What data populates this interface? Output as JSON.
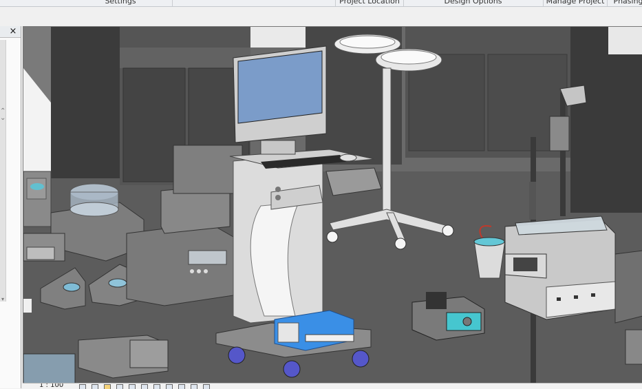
{
  "ribbon": {
    "panels": [
      {
        "label": "Settings"
      },
      {
        "label": "Project Location"
      },
      {
        "label": "Design Options"
      },
      {
        "label": "Manage Project"
      },
      {
        "label": "Phasing"
      }
    ]
  },
  "left_panel": {
    "close_glyph": "×"
  },
  "viewport": {
    "content": "3D view of medical equipment (ultrasound cart, IV pole, basin stand, lab devices)"
  },
  "view_control_bar": {
    "scale": "1 : 100",
    "icons": [
      "detail-level-icon",
      "visual-style-icon",
      "sun-path-icon",
      "shadows-icon",
      "crop-view-icon",
      "show-crop-icon",
      "lock-3d-icon",
      "temporary-hide-icon",
      "reveal-hidden-icon",
      "analytical-model-icon",
      "highlight-displacement-icon"
    ]
  },
  "colors": {
    "monitor_screen": "#7b9cc9",
    "printer_blue": "#3a8fe6",
    "casters": "#5557c9",
    "teal_device": "#46c6cf"
  }
}
